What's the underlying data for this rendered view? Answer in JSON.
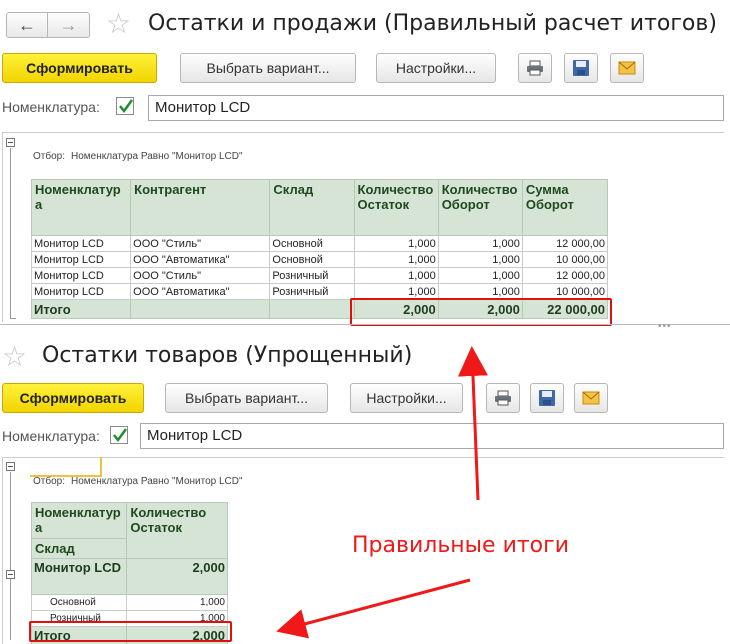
{
  "top": {
    "title": "Остатки и продажи (Правильный расчет итогов)",
    "nav_back": "←",
    "nav_forward": "→",
    "generate_label": "Сформировать",
    "variant_label": "Выбрать вариант...",
    "settings_label": "Настройки...",
    "field_label": "Номенклатура:",
    "field_value": "Монитор LCD",
    "filter_text": "Отбор:",
    "filter_value": "Номенклатура Равно \"Монитор LCD\"",
    "columns": [
      "Номенклатура",
      "Контрагент",
      "Склад",
      "Количество Остаток",
      "Количество Оборот",
      "Сумма Оборот"
    ],
    "rows": [
      [
        "Монитор LCD",
        "ООО \"Стиль\"",
        "Основной",
        "1,000",
        "1,000",
        "12 000,00"
      ],
      [
        "Монитор LCD",
        "ООО \"Автоматика\"",
        "Основной",
        "1,000",
        "1,000",
        "10 000,00"
      ],
      [
        "Монитор LCD",
        "ООО \"Стиль\"",
        "Розничный",
        "1,000",
        "1,000",
        "12 000,00"
      ],
      [
        "Монитор LCD",
        "ООО \"Автоматика\"",
        "Розничный",
        "1,000",
        "1,000",
        "10 000,00"
      ]
    ],
    "total_label": "Итого",
    "totals": [
      "2,000",
      "2,000",
      "22 000,00"
    ]
  },
  "bottom": {
    "title": "Остатки товаров (Упрощенный)",
    "generate_label": "Сформировать",
    "variant_label": "Выбрать вариант...",
    "settings_label": "Настройки...",
    "field_label": "Номенклатура:",
    "field_value": "Монитор LCD",
    "filter_text": "Отбор:",
    "filter_value": "Номенклатура Равно \"Монитор LCD\"",
    "col1_line1": "Номенклатура",
    "col1_line2": "Склад",
    "col2": "Количество Остаток",
    "group_name": "Монитор LCD",
    "group_value": "2,000",
    "rows": [
      [
        "Основной",
        "1,000"
      ],
      [
        "Розничный",
        "1,000"
      ]
    ],
    "total_label": "Итого",
    "total_value": "2,000"
  },
  "annotation": "Правильные итоги",
  "colors": {
    "primary": "#f5d800",
    "header_bg": "#d6e4d6",
    "header_text": "#1e4a1e",
    "annotation": "#f01818"
  }
}
